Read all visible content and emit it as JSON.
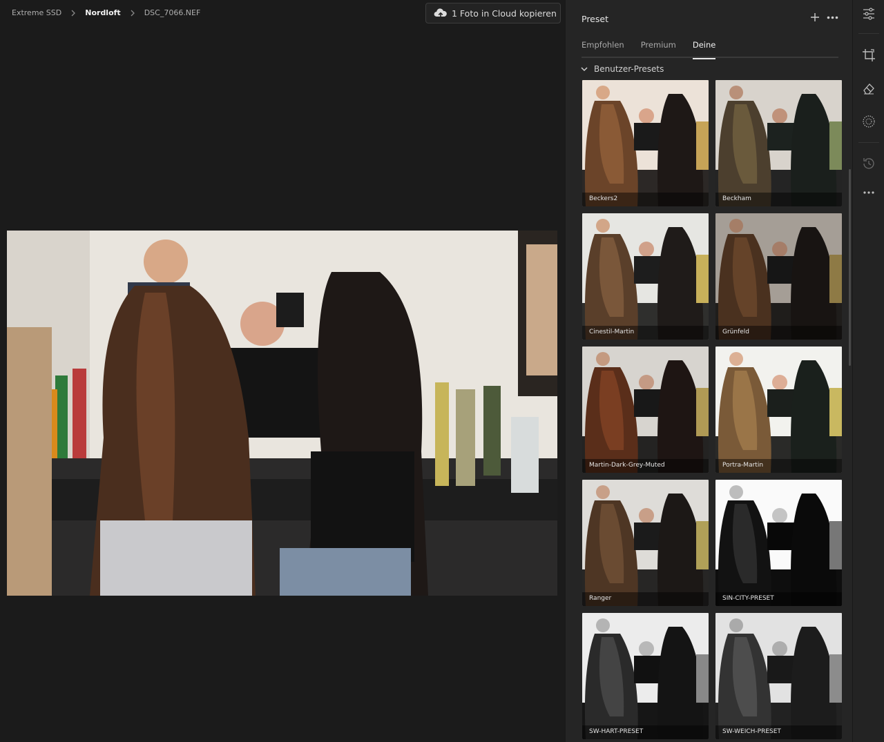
{
  "breadcrumb": {
    "items": [
      "Extreme SSD",
      "Nordloft",
      "DSC_7066.NEF"
    ]
  },
  "cloud_button": {
    "label": "1 Foto in Cloud kopieren",
    "icon": "cloud-upload-icon"
  },
  "photo": {
    "description_icon": "photo-preview"
  },
  "panel": {
    "title": "Preset",
    "actions": {
      "add_icon": "plus-icon",
      "more_icon": "more-icon"
    },
    "tabs": [
      {
        "label": "Empfohlen",
        "active": false
      },
      {
        "label": "Premium",
        "active": false
      },
      {
        "label": "Deine",
        "active": true
      }
    ],
    "group": {
      "label": "Benutzer-Presets",
      "expanded": true
    },
    "presets": [
      {
        "label": "Beckers2",
        "style": "warm"
      },
      {
        "label": "Beckham",
        "style": "cool-green"
      },
      {
        "label": "Cinestil-Martin",
        "style": "bright"
      },
      {
        "label": "Grünfeld",
        "style": "dark"
      },
      {
        "label": "Martin-Dark-Grey-Muted",
        "style": "muted"
      },
      {
        "label": "Portra-Martin",
        "style": "portra"
      },
      {
        "label": "Ranger",
        "style": "ranger"
      },
      {
        "label": "SIN-CITY-PRESET",
        "style": "bw-hard"
      },
      {
        "label": "SW-HART-PRESET",
        "style": "bw"
      },
      {
        "label": "SW-WEICH-PRESET",
        "style": "bw-soft"
      }
    ]
  },
  "toolbar": {
    "tools": [
      "edit-sliders-icon",
      "crop-icon",
      "healing-eraser-icon",
      "masking-icon",
      "history-icon",
      "more-tools-icon"
    ]
  },
  "colors": {
    "background": "#1b1b1b",
    "panel": "#252525",
    "accent_text": "#f2f2f2"
  }
}
